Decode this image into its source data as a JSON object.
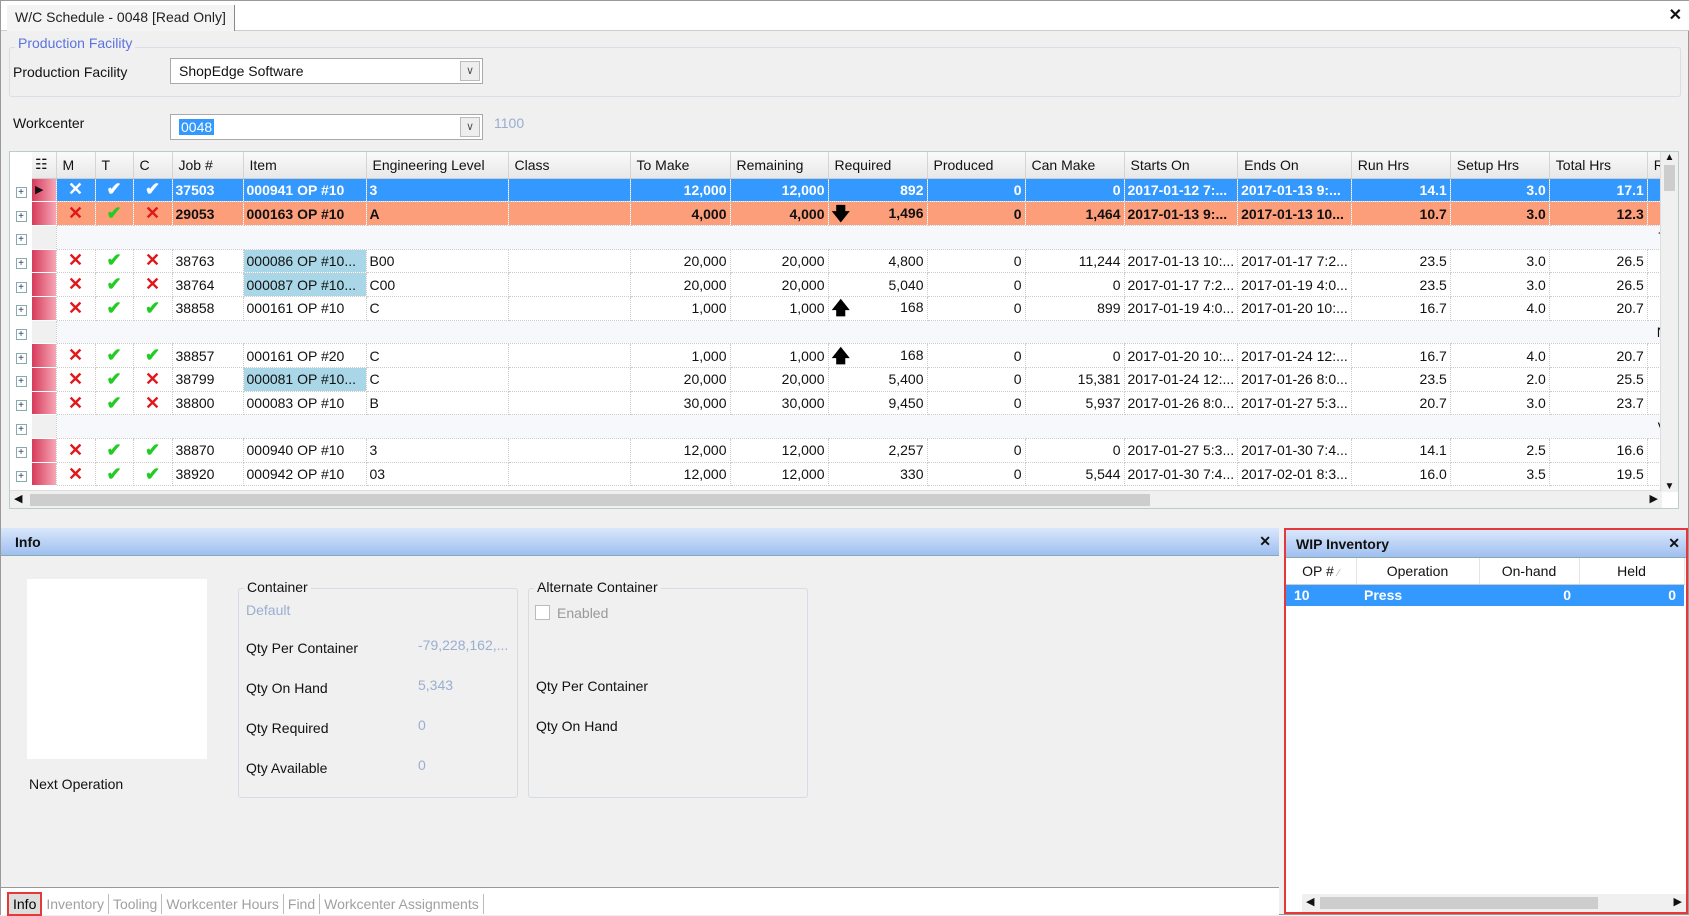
{
  "window": {
    "tab_title": "W/C Schedule - 0048 [Read Only]"
  },
  "filters": {
    "group_title": "Production Facility",
    "facility_label": "Production Facility",
    "facility_value": "ShopEdge Software",
    "workcenter_label": "Workcenter",
    "workcenter_value": "0048",
    "workcenter_desc": "1100"
  },
  "grid": {
    "columns": [
      "M",
      "T",
      "C",
      "Job #",
      "Item",
      "Engineering Level",
      "Class",
      "To Make",
      "Remaining",
      "Required",
      "Produced",
      "Can Make",
      "Starts On",
      "Ends On",
      "Run Hrs",
      "Setup Hrs",
      "Total Hrs",
      "R"
    ],
    "rows": [
      {
        "state": "selected",
        "m": "x",
        "t": "check",
        "c": "check",
        "job": "37503",
        "item": "000941 OP #10",
        "eng": "3",
        "cls": "",
        "to_make": "12,000",
        "remaining": "12,000",
        "arrow": "",
        "required": "892",
        "produced": "0",
        "can_make": "0",
        "starts": "2017-01-12 7:...",
        "ends": "2017-01-13 9:...",
        "run": "14.1",
        "setup": "3.0",
        "total": "17.1"
      },
      {
        "state": "late",
        "m": "x",
        "t": "check",
        "c": "x",
        "job": "29053",
        "item": "000163 OP #10",
        "eng": "A",
        "cls": "",
        "to_make": "4,000",
        "remaining": "4,000",
        "arrow": "down",
        "required": "1,496",
        "produced": "0",
        "can_make": "1,464",
        "starts": "2017-01-13 9:...",
        "ends": "2017-01-13 10...",
        "run": "10.7",
        "setup": "3.0",
        "total": "12.3"
      },
      {
        "state": "group",
        "tail": "T"
      },
      {
        "m": "x",
        "t": "check",
        "c": "x",
        "job": "38763",
        "item": "000086 OP #10...",
        "item_hl": true,
        "eng": "B00",
        "cls": "",
        "to_make": "20,000",
        "remaining": "20,000",
        "arrow": "",
        "required": "4,800",
        "produced": "0",
        "can_make": "11,244",
        "starts": "2017-01-13 10:...",
        "ends": "2017-01-17 7:2...",
        "run": "23.5",
        "setup": "3.0",
        "total": "26.5"
      },
      {
        "m": "x",
        "t": "check",
        "c": "x",
        "job": "38764",
        "item": "000087 OP #10...",
        "item_hl": true,
        "eng": "C00",
        "cls": "",
        "to_make": "20,000",
        "remaining": "20,000",
        "arrow": "",
        "required": "5,040",
        "produced": "0",
        "can_make": "0",
        "starts": "2017-01-17 7:2...",
        "ends": "2017-01-19 4:0...",
        "run": "23.5",
        "setup": "3.0",
        "total": "26.5"
      },
      {
        "m": "x",
        "t": "check",
        "c": "check",
        "job": "38858",
        "item": "000161 OP #10",
        "eng": "C",
        "cls": "",
        "to_make": "1,000",
        "remaining": "1,000",
        "arrow": "up",
        "required": "168",
        "produced": "0",
        "can_make": "899",
        "starts": "2017-01-19 4:0...",
        "ends": "2017-01-20 10:...",
        "run": "16.7",
        "setup": "4.0",
        "total": "20.7"
      },
      {
        "state": "group",
        "tail": "N"
      },
      {
        "m": "x",
        "t": "check",
        "c": "check",
        "job": "38857",
        "item": "000161 OP #20",
        "eng": "C",
        "cls": "",
        "to_make": "1,000",
        "remaining": "1,000",
        "arrow": "up",
        "required": "168",
        "produced": "0",
        "can_make": "0",
        "starts": "2017-01-20 10:...",
        "ends": "2017-01-24 12:...",
        "run": "16.7",
        "setup": "4.0",
        "total": "20.7"
      },
      {
        "m": "x",
        "t": "check",
        "c": "x",
        "job": "38799",
        "item": "000081 OP #10...",
        "item_hl": true,
        "eng": "C",
        "cls": "",
        "to_make": "20,000",
        "remaining": "20,000",
        "arrow": "",
        "required": "5,400",
        "produced": "0",
        "can_make": "15,381",
        "starts": "2017-01-24 12:...",
        "ends": "2017-01-26 8:0...",
        "run": "23.5",
        "setup": "2.0",
        "total": "25.5"
      },
      {
        "m": "x",
        "t": "check",
        "c": "x",
        "job": "38800",
        "item": "000083 OP #10",
        "eng": "B",
        "cls": "",
        "to_make": "30,000",
        "remaining": "30,000",
        "arrow": "",
        "required": "9,450",
        "produced": "0",
        "can_make": "5,937",
        "starts": "2017-01-26 8:0...",
        "ends": "2017-01-27 5:3...",
        "run": "20.7",
        "setup": "3.0",
        "total": "23.7"
      },
      {
        "state": "group",
        "tail": "V"
      },
      {
        "m": "x",
        "t": "check",
        "c": "check",
        "job": "38870",
        "item": "000940 OP #10",
        "eng": "3",
        "cls": "",
        "to_make": "12,000",
        "remaining": "12,000",
        "arrow": "",
        "required": "2,257",
        "produced": "0",
        "can_make": "0",
        "starts": "2017-01-27 5:3...",
        "ends": "2017-01-30 7:4...",
        "run": "14.1",
        "setup": "2.5",
        "total": "16.6"
      },
      {
        "m": "x",
        "t": "check",
        "c": "check",
        "job": "38920",
        "item": "000942 OP #10",
        "eng": "03",
        "cls": "",
        "to_make": "12,000",
        "remaining": "12,000",
        "arrow": "",
        "required": "330",
        "produced": "0",
        "can_make": "5,544",
        "starts": "2017-01-30 7:4...",
        "ends": "2017-02-01 8:3...",
        "run": "16.0",
        "setup": "3.5",
        "total": "19.5"
      }
    ]
  },
  "info": {
    "title": "Info",
    "next_operation": "Next Operation",
    "container_title": "Container",
    "container_default": "Default",
    "qty_per_container_label": "Qty Per Container",
    "qty_per_container": "-79,228,162,...",
    "qty_on_hand_label": "Qty On Hand",
    "qty_on_hand": "5,343",
    "qty_required_label": "Qty Required",
    "qty_required": "0",
    "qty_available_label": "Qty Available",
    "qty_available": "0",
    "alt_title": "Alternate Container",
    "alt_enabled": "Enabled",
    "alt_qty_per_container": "Qty Per Container",
    "alt_qty_on_hand": "Qty On Hand"
  },
  "wip": {
    "title": "WIP Inventory",
    "columns": [
      "OP #",
      "Operation",
      "On-hand",
      "Held"
    ],
    "rows": [
      {
        "op": "10",
        "operation": "Press",
        "on_hand": "0",
        "held": "0"
      }
    ]
  },
  "bottom_tabs": [
    "Info",
    "Inventory",
    "Tooling",
    "Workcenter Hours",
    "Find",
    "Workcenter Assignments"
  ],
  "icons": {
    "close": "close-icon",
    "dropdown": "chevron-down-icon",
    "expand": "plus-expand-icon",
    "check": "check-icon",
    "x": "x-icon",
    "arrow_up": "arrow-up-icon",
    "arrow_down": "arrow-down-icon"
  },
  "colors": {
    "selected": "#3399ff",
    "late": "#fd9e7a",
    "highlight": "#e53838"
  }
}
